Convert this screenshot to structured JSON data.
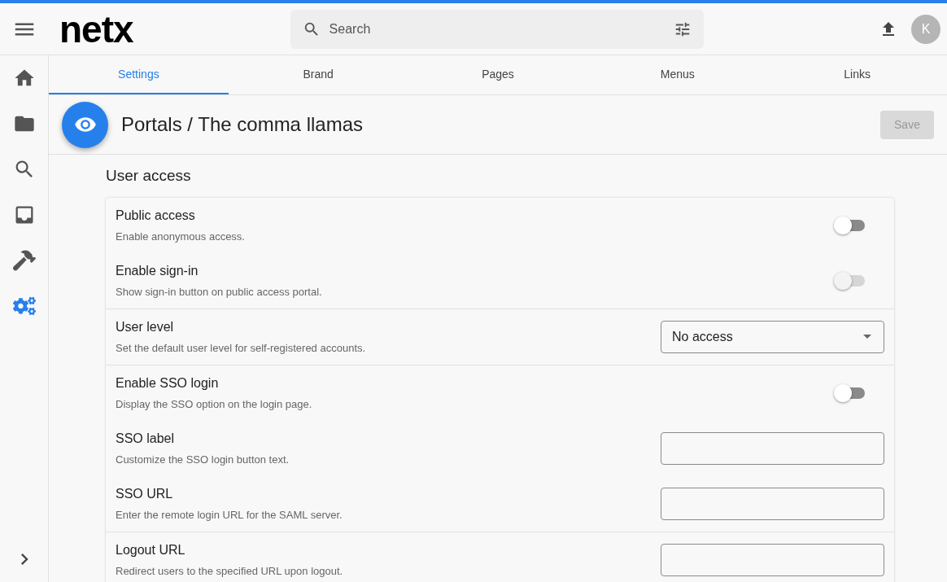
{
  "topbar": {
    "logo": "netx",
    "search": {
      "placeholder": "Search"
    },
    "avatar": "K"
  },
  "sidebar": {
    "items": [
      {
        "selected": false
      },
      {
        "selected": false
      },
      {
        "selected": false
      },
      {
        "selected": false
      },
      {
        "selected": false
      },
      {
        "selected": true
      }
    ]
  },
  "tabs": [
    {
      "label": "Settings",
      "selected": true
    },
    {
      "label": "Brand",
      "selected": false
    },
    {
      "label": "Pages",
      "selected": false
    },
    {
      "label": "Menus",
      "selected": false
    },
    {
      "label": "Links",
      "selected": false
    }
  ],
  "header": {
    "title": "Portals / The comma llamas",
    "save": {
      "label": "Save",
      "disabled": true
    }
  },
  "section": {
    "title": "User access",
    "groups": [
      [
        {
          "kind": "toggle",
          "label": "Public access",
          "description": "Enable anonymous access.",
          "on": false,
          "disabled": false
        },
        {
          "kind": "toggle",
          "label": "Enable sign-in",
          "description": "Show sign-in button on public access portal.",
          "on": false,
          "disabled": true
        }
      ],
      [
        {
          "kind": "select",
          "label": "User level",
          "description": "Set the default user level for self-registered accounts.",
          "value": "No access"
        }
      ],
      [
        {
          "kind": "toggle",
          "label": "Enable SSO login",
          "description": "Display the SSO option on the login page.",
          "on": false,
          "disabled": false
        },
        {
          "kind": "text",
          "label": "SSO label",
          "description": "Customize the SSO login button text."
        },
        {
          "kind": "text",
          "label": "SSO URL",
          "description": "Enter the remote login URL for the SAML server."
        }
      ],
      [
        {
          "kind": "text",
          "label": "Logout URL",
          "description": "Redirect users to the specified URL upon logout."
        }
      ]
    ]
  }
}
